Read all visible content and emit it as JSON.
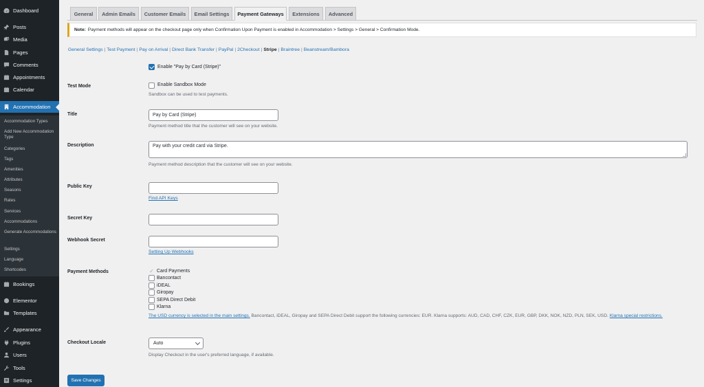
{
  "sidebar": {
    "items": [
      {
        "label": "Dashboard",
        "icon": "dashboard-icon"
      },
      {
        "label": "Posts",
        "icon": "pin-icon"
      },
      {
        "label": "Media",
        "icon": "media-icon"
      },
      {
        "label": "Pages",
        "icon": "pages-icon"
      },
      {
        "label": "Comments",
        "icon": "comments-icon"
      },
      {
        "label": "Appointments",
        "icon": "calendar-icon"
      },
      {
        "label": "Calendar",
        "icon": "calendar-icon"
      },
      {
        "label": "Accommodation",
        "icon": "building-icon"
      },
      {
        "label": "Bookings",
        "icon": "calendar-icon"
      },
      {
        "label": "Elementor",
        "icon": "elementor-icon"
      },
      {
        "label": "Templates",
        "icon": "folder-icon"
      },
      {
        "label": "Appearance",
        "icon": "brush-icon"
      },
      {
        "label": "Plugins",
        "icon": "plugin-icon"
      },
      {
        "label": "Users",
        "icon": "users-icon"
      },
      {
        "label": "Tools",
        "icon": "wrench-icon"
      },
      {
        "label": "Settings",
        "icon": "settings-icon"
      }
    ],
    "submenu": [
      "Accommodation Types",
      "Add New Accommodation Type",
      "Categories",
      "Tags",
      "Amenities",
      "Attributes",
      "Seasons",
      "Rates",
      "Services",
      "Accommodations",
      "Generate Accommodations",
      "Settings",
      "Language",
      "Shortcodes"
    ]
  },
  "tabs": [
    "General",
    "Admin Emails",
    "Customer Emails",
    "Email Settings",
    "Payment Gateways",
    "Extensions",
    "Advanced"
  ],
  "notice": {
    "label": "Note:",
    "text": "Payment methods will appear on the checkout page only when Confirmation Upon Payment is enabled in Accommodation > Settings > General > Confirmation Mode."
  },
  "sections": [
    "General Settings",
    "Test Payment",
    "Pay on Arrival",
    "Direct Bank Transfer",
    "PayPal",
    "2Checkout",
    "Stripe",
    "Braintree",
    "Beanstream/Bambora"
  ],
  "form": {
    "enable_label": "Enable \"Pay by Card (Stripe)\"",
    "test_mode": {
      "label": "Test Mode",
      "checkbox_label": "Enable Sandbox Mode",
      "desc": "Sandbox can be used to test payments."
    },
    "title": {
      "label": "Title",
      "value": "Pay by Card (Stripe)",
      "desc": "Payment method title that the customer will see on your website."
    },
    "description": {
      "label": "Description",
      "value": "Pay with your credit card via Stripe.",
      "desc": "Payment method description that the customer will see on your website."
    },
    "public_key": {
      "label": "Public Key",
      "value": "",
      "link": "Find API Keys"
    },
    "secret_key": {
      "label": "Secret Key",
      "value": ""
    },
    "webhook_secret": {
      "label": "Webhook Secret",
      "value": "",
      "link": "Setting Up Webhooks"
    },
    "payment_methods": {
      "label": "Payment Methods",
      "items": [
        {
          "label": "Card Payments",
          "checked": true,
          "locked": true
        },
        {
          "label": "Bancontact",
          "checked": false
        },
        {
          "label": "iDEAL",
          "checked": false
        },
        {
          "label": "Giropay",
          "checked": false
        },
        {
          "label": "SEPA Direct Debit",
          "checked": false
        },
        {
          "label": "Klarna",
          "checked": false
        }
      ],
      "note_link": "The USD currency is selected in the main settings.",
      "note_text": " Bancontact, iDEAL, Giropay and SEPA Direct Debit support the following currencies: EUR. Klarna supports: AUD, CAD, CHF, CZK, EUR, GBP, DKK, NOK, NZD, PLN, SEK, USD. ",
      "note_link2": "Klarna special restrictions."
    },
    "checkout_locale": {
      "label": "Checkout Locale",
      "value": "Auto",
      "desc": "Display Checkout in the user's preferred language, if available."
    },
    "save_label": "Save Changes"
  },
  "colors": {
    "accent": "#2271b1",
    "sidebar": "#1d2327",
    "notice_border": "#dba617"
  }
}
